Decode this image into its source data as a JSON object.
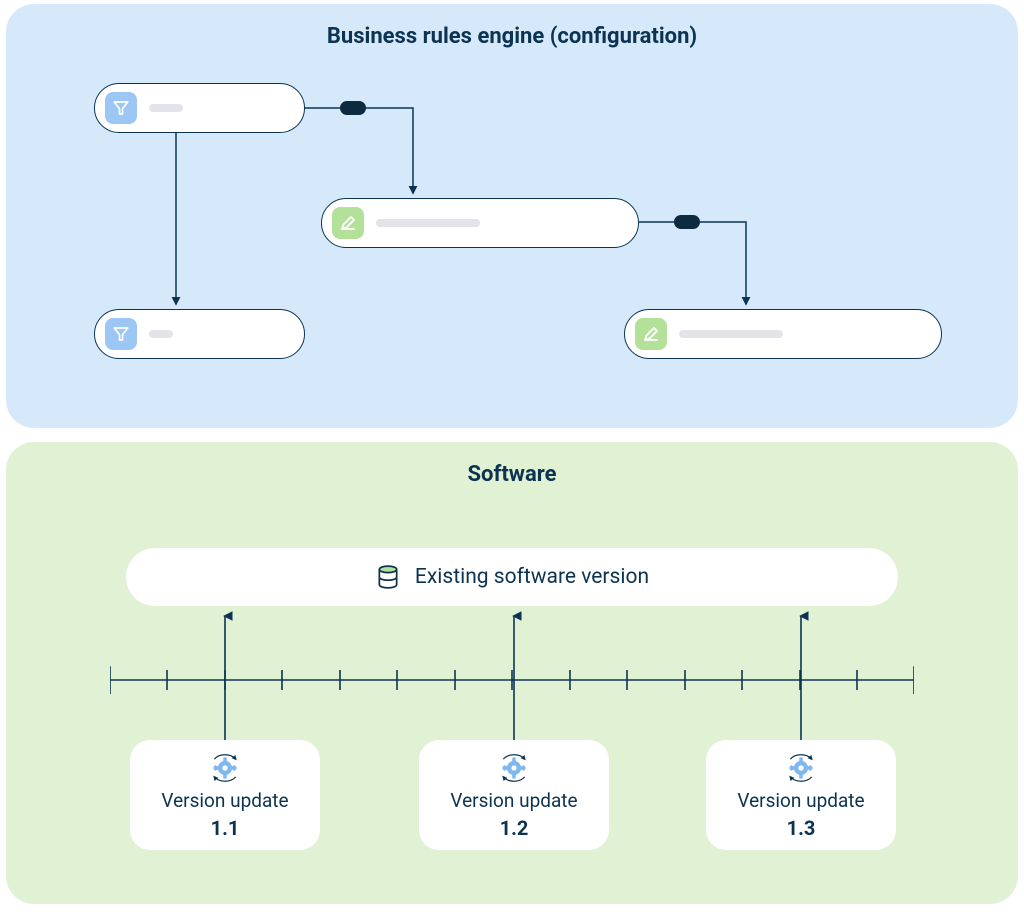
{
  "top": {
    "title": "Business rules engine (configuration)",
    "nodes": [
      {
        "type": "filter"
      },
      {
        "type": "edit"
      },
      {
        "type": "filter"
      },
      {
        "type": "edit"
      }
    ]
  },
  "bottom": {
    "title": "Software",
    "existing_label": "Existing software version",
    "cards": [
      {
        "label": "Version update",
        "version": "1.1"
      },
      {
        "label": "Version update",
        "version": "1.2"
      },
      {
        "label": "Version update",
        "version": "1.3"
      }
    ]
  }
}
